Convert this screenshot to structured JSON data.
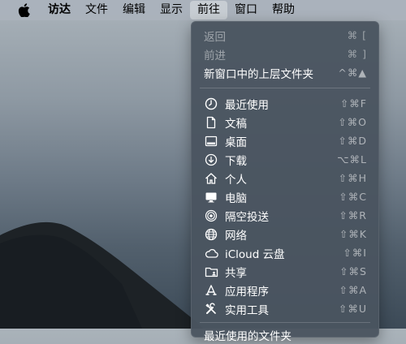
{
  "menubar": {
    "apple_icon": "apple-logo-icon",
    "items": [
      {
        "label": "访达"
      },
      {
        "label": "文件"
      },
      {
        "label": "编辑"
      },
      {
        "label": "显示"
      },
      {
        "label": "前往"
      },
      {
        "label": "窗口"
      },
      {
        "label": "帮助"
      }
    ]
  },
  "dropdown": {
    "nav": [
      {
        "label": "返回",
        "shortcut": "⌘ [",
        "enabled": false
      },
      {
        "label": "前进",
        "shortcut": "⌘ ]",
        "enabled": false
      },
      {
        "label": "新窗口中的上层文件夹",
        "shortcut": "^⌘▲",
        "enabled": true
      }
    ],
    "places": [
      {
        "label": "最近使用",
        "shortcut": "⇧⌘F",
        "icon": "clock-icon"
      },
      {
        "label": "文稿",
        "shortcut": "⇧⌘O",
        "icon": "document-icon"
      },
      {
        "label": "桌面",
        "shortcut": "⇧⌘D",
        "icon": "desktop-icon"
      },
      {
        "label": "下载",
        "shortcut": "⌥⌘L",
        "icon": "download-icon"
      },
      {
        "label": "个人",
        "shortcut": "⇧⌘H",
        "icon": "home-icon"
      },
      {
        "label": "电脑",
        "shortcut": "⇧⌘C",
        "icon": "computer-icon"
      },
      {
        "label": "隔空投送",
        "shortcut": "⇧⌘R",
        "icon": "airdrop-icon"
      },
      {
        "label": "网络",
        "shortcut": "⇧⌘K",
        "icon": "network-icon"
      },
      {
        "label": "iCloud 云盘",
        "shortcut": "⇧⌘I",
        "icon": "cloud-icon"
      },
      {
        "label": "共享",
        "shortcut": "⇧⌘S",
        "icon": "shared-folder-icon"
      },
      {
        "label": "应用程序",
        "shortcut": "⇧⌘A",
        "icon": "applications-icon"
      },
      {
        "label": "实用工具",
        "shortcut": "⇧⌘U",
        "icon": "utilities-icon"
      }
    ],
    "partial_item": {
      "label": "最近使用的文件夹"
    }
  }
}
